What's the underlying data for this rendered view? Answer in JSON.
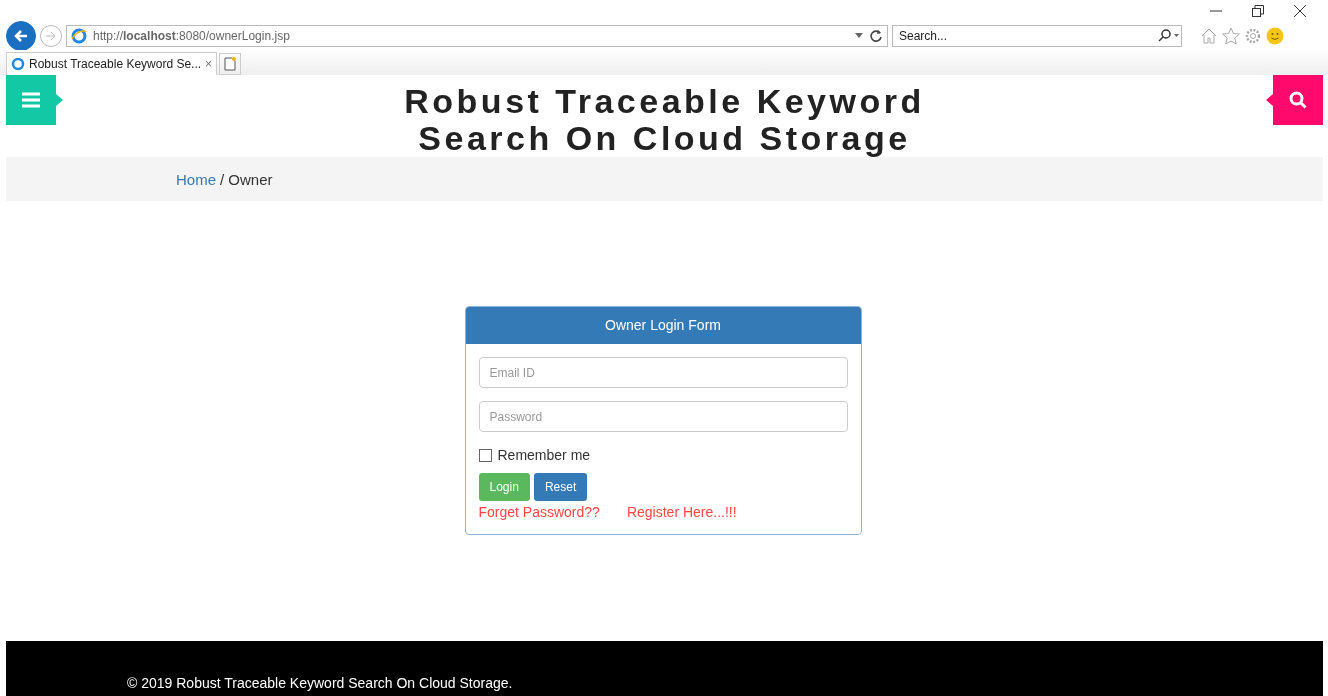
{
  "browser": {
    "url": "http://**localhost**:8080/ownerLogin.jsp",
    "search": {
      "placeholder": "Search..."
    },
    "tab": {
      "title": "Robust Traceable Keyword Se...",
      "close": "×"
    }
  },
  "header": {
    "title_lines": [
      "Robust Traceable Keyword",
      "Search On Cloud Storage"
    ]
  },
  "breadcrumb": [
    {
      "label": "Home",
      "kind": "link"
    },
    {
      "label": "/ Owner",
      "kind": "text"
    }
  ],
  "login_form": {
    "title": "Owner Login Form",
    "fields": [
      {
        "placeholder": "Email ID"
      },
      {
        "placeholder": "Password"
      }
    ],
    "remember": {
      "label": "Remember me",
      "checked": false
    },
    "buttons": [
      {
        "label": "Login",
        "kind": "success"
      },
      {
        "label": "Reset",
        "kind": "primary"
      }
    ],
    "links": [
      "Forget Password??",
      "Register Here...!!!"
    ]
  },
  "footer": {
    "text": "© 2019 Robust Traceable Keyword Search On Cloud Storage."
  }
}
